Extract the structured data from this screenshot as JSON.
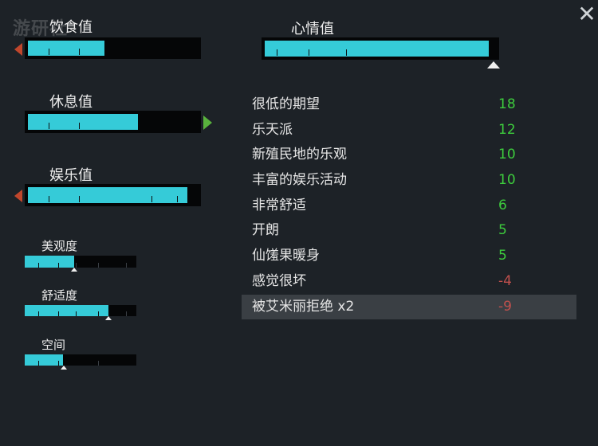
{
  "watermark": "游研社",
  "close_symbol": "✕",
  "needs": {
    "hunger": {
      "label": "饮食值",
      "level": 0.45
    },
    "rest": {
      "label": "休息值",
      "level": 0.65
    },
    "recreation": {
      "label": "娱乐值",
      "level": 0.94
    },
    "beauty": {
      "label": "美观度",
      "level": 0.44,
      "threshold": 0.44
    },
    "comfort": {
      "label": "舒适度",
      "level": 0.75,
      "threshold": 0.75
    },
    "space": {
      "label": "空间",
      "level": 0.34,
      "threshold": 0.35
    }
  },
  "mood": {
    "label": "心情值",
    "level": 0.97,
    "threshold": 0.99
  },
  "thoughts": [
    {
      "label": "很低的期望",
      "value": "18",
      "type": "positive"
    },
    {
      "label": "乐天派",
      "value": "12",
      "type": "positive"
    },
    {
      "label": "新殖民地的乐观",
      "value": "10",
      "type": "positive"
    },
    {
      "label": "丰富的娱乐活动",
      "value": "10",
      "type": "positive"
    },
    {
      "label": "非常舒适",
      "value": "6",
      "type": "positive"
    },
    {
      "label": "开朗",
      "value": "5",
      "type": "positive"
    },
    {
      "label": "仙馐果暖身",
      "value": "5",
      "type": "positive"
    },
    {
      "label": "感觉很坏",
      "value": "-4",
      "type": "negative"
    },
    {
      "label": "被艾米丽拒绝 x2",
      "value": "-9",
      "type": "negative"
    }
  ],
  "colors": {
    "bar_fill": "#35cbd8",
    "positive": "#3dcc3d",
    "negative": "#c0504d",
    "arrow_down": "#c0462c",
    "arrow_up": "#59b33d"
  }
}
